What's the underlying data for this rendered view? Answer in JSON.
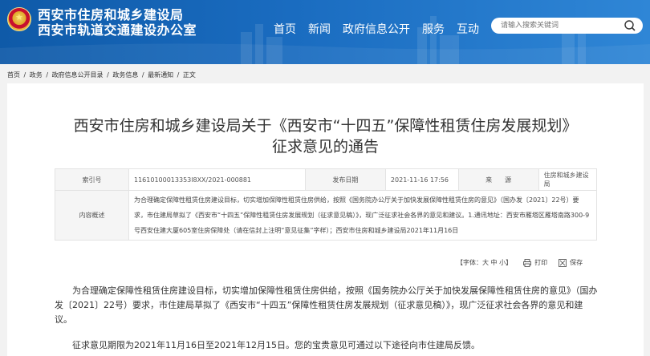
{
  "header": {
    "site_name_line1": "西安市住房和城乡建设局",
    "site_name_line2": "西安市轨道交通建设办公室",
    "nav": [
      "首页",
      "新闻",
      "政府信息公开",
      "服务",
      "互动"
    ],
    "search_placeholder": "请输入搜索关键词",
    "colors": {
      "bar_start": "#0f5aa8",
      "bar_end": "#2f86d6"
    }
  },
  "breadcrumb": [
    "首页",
    "政务",
    "政府信息公开目录",
    "政务信息",
    "最新通知",
    "正文"
  ],
  "breadcrumb_sep": " / ",
  "article": {
    "title_line1": "西安市住房和城乡建设局关于《西安市“十四五”保障性租赁住房发展规划》",
    "title_line2": "征求意见的通告",
    "meta": {
      "index_label": "索引号",
      "index_value": "11610100013353l8XX/2021-000881",
      "date_label": "发布日期",
      "date_value": "2021-11-16 17:56",
      "source_label": "来　　源",
      "source_value": "住房和城乡建设局",
      "summary_label": "内容概述",
      "summary_value": "为合理确定保障性租赁住房建设目标，切实增加保障性租赁住房供给，按照《国务院办公厅关于加快发展保障性租赁住房的意见》（国办发〔2021〕22号）要求，市住建局草拟了《西安市“十四五”保障性租赁住房发展规划（征求意见稿）》，现广泛征求社会各界的意见和建议。1.通讯地址：西安市雁塔区雁塔南路300-9号西安住建大厦605室住房保障处（请在信封上注明“意见征集”字样）；西安市住房和城乡建设局2021年11月16日"
    },
    "tools": {
      "font_size_label": "【字体：大 中 小】",
      "print_label": "打印",
      "save_label": "保存"
    },
    "paragraphs": [
      "为合理确定保障性租赁住房建设目标，切实增加保障性租赁住房供给，按照《国务院办公厅关于加快发展保障性租赁住房的意见》（国办发〔2021〕22号）要求，市住建局草拟了《西安市“十四五”保障性租赁住房发展规划（征求意见稿）》，现广泛征求社会各界的意见和建议。",
      "征求意见期限为2021年11月16日至2021年12月15日。您的宝贵意见可通过以下途径向市住建局反馈。"
    ]
  }
}
